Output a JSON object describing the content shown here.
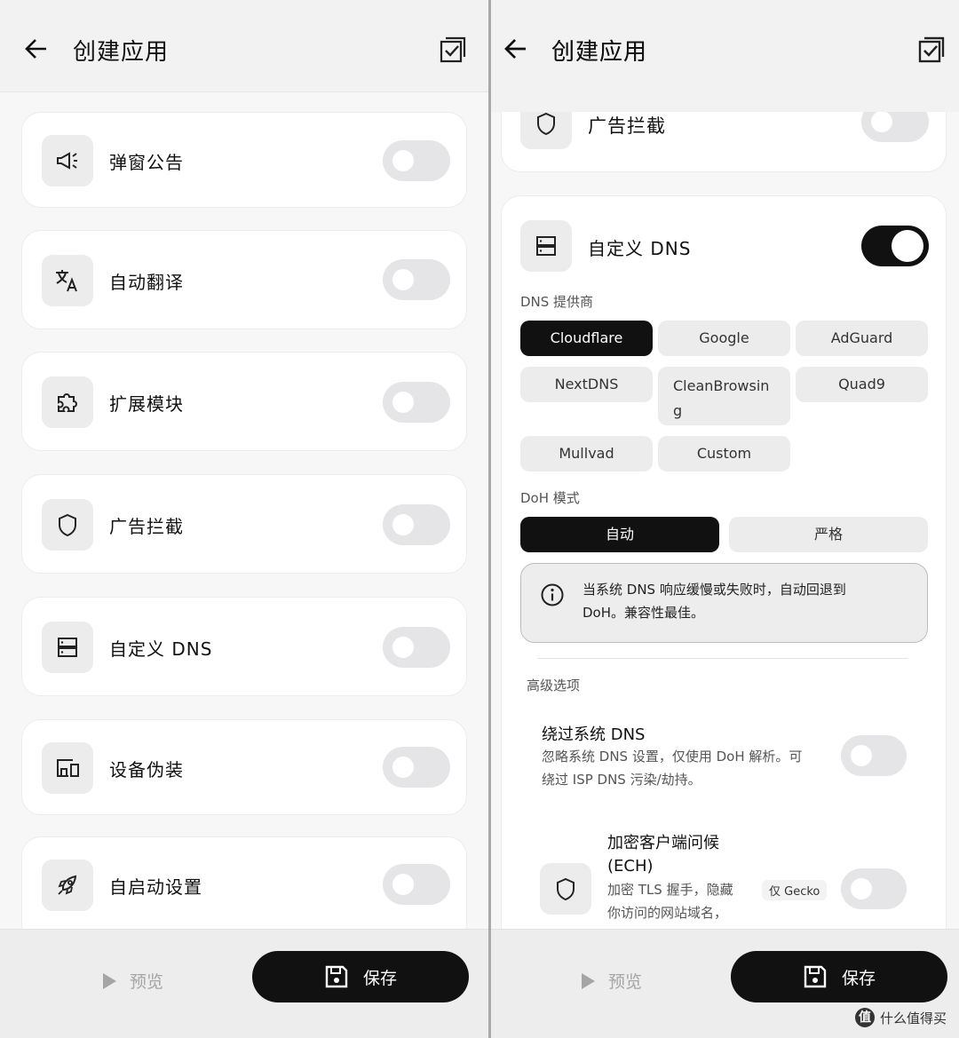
{
  "left": {
    "title": "创建应用",
    "cards": [
      {
        "label": "弹窗公告",
        "icon": "megaphone-icon"
      },
      {
        "label": "自动翻译",
        "icon": "translate-icon"
      },
      {
        "label": "扩展模块",
        "icon": "puzzle-icon"
      },
      {
        "label": "广告拦截",
        "icon": "shield-icon"
      },
      {
        "label": "自定义 DNS",
        "icon": "server-icon"
      },
      {
        "label": "设备伪装",
        "icon": "devices-icon"
      },
      {
        "label": "自启动设置",
        "icon": "rocket-icon"
      }
    ],
    "preview_label": "预览",
    "save_label": "保存"
  },
  "right": {
    "title": "创建应用",
    "adblock_label": "广告拦截",
    "dns_label": "自定义 DNS",
    "dns_enabled": true,
    "provider_section": "DNS 提供商",
    "providers": [
      "Cloudflare",
      "Google",
      "AdGuard",
      "NextDNS",
      "CleanBrowsin\ng",
      "Quad9",
      "Mullvad",
      "Custom"
    ],
    "selected_provider": "Cloudflare",
    "doh_section": "DoH 模式",
    "doh_modes": [
      "自动",
      "严格"
    ],
    "selected_doh": "自动",
    "info_line1": "当系统 DNS 响应缓慢或失败时，自动回退到",
    "info_line2": "DoH。兼容性最佳。",
    "advanced_section": "高级选项",
    "bypass_title": "绕过系统 DNS",
    "bypass_desc1": "忽略系统 DNS 设置，仅使用 DoH 解析。可",
    "bypass_desc2": "绕过 ISP DNS 污染/劫持。",
    "ech_title1": "加密客户端问候",
    "ech_title2": "(ECH)",
    "ech_desc1": "加密 TLS 握手，隐藏",
    "ech_desc2": "你访问的网站域名，",
    "ech_badge": "仅 Gecko",
    "preview_label": "预览",
    "save_label": "保存",
    "watermark": "什么值得买",
    "watermark_mark": "值"
  },
  "colors": {
    "accent": "#111111",
    "toggle_off": "#e5e5e7",
    "card_bg": "#ffffff",
    "page_bg": "#f7f7f8"
  }
}
